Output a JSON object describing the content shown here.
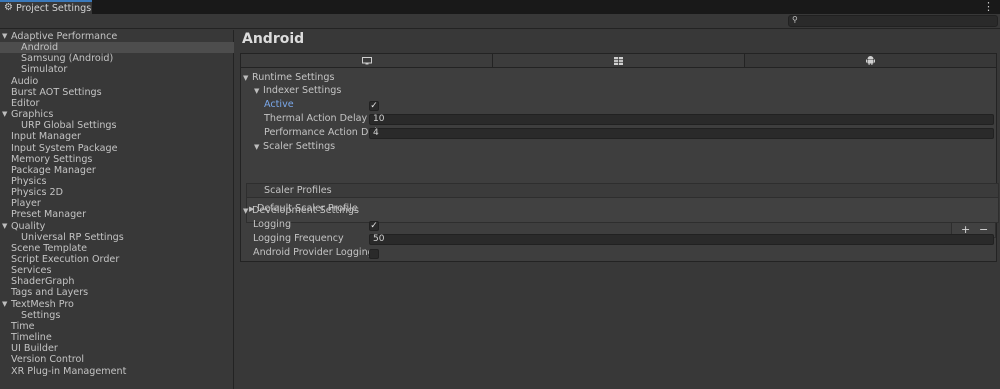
{
  "window": {
    "tab_title": "Project Settings",
    "tab_icon": "gear-icon",
    "menu_icon": "kebab-menu-icon"
  },
  "search": {
    "placeholder": "",
    "value": ""
  },
  "sidebar": {
    "items": [
      {
        "label": "Adaptive Performance",
        "foldout": "▼"
      },
      {
        "label": "Android"
      },
      {
        "label": "Samsung (Android)"
      },
      {
        "label": "Simulator"
      },
      {
        "label": "Audio"
      },
      {
        "label": "Burst AOT Settings"
      },
      {
        "label": "Editor"
      },
      {
        "label": "Graphics",
        "foldout": "▼"
      },
      {
        "label": "URP Global Settings"
      },
      {
        "label": "Input Manager"
      },
      {
        "label": "Input System Package"
      },
      {
        "label": "Memory Settings"
      },
      {
        "label": "Package Manager"
      },
      {
        "label": "Physics"
      },
      {
        "label": "Physics 2D"
      },
      {
        "label": "Player"
      },
      {
        "label": "Preset Manager"
      },
      {
        "label": "Quality",
        "foldout": "▼"
      },
      {
        "label": "Universal RP Settings"
      },
      {
        "label": "Scene Template"
      },
      {
        "label": "Script Execution Order"
      },
      {
        "label": "Services"
      },
      {
        "label": "ShaderGraph"
      },
      {
        "label": "Tags and Layers"
      },
      {
        "label": "TextMesh Pro",
        "foldout": "▼"
      },
      {
        "label": "Settings"
      },
      {
        "label": "Time"
      },
      {
        "label": "Timeline"
      },
      {
        "label": "UI Builder"
      },
      {
        "label": "Version Control"
      },
      {
        "label": "XR Plug-in Management"
      }
    ]
  },
  "main": {
    "title": "Android",
    "platform_tabs": [
      {
        "icon": "desktop-icon"
      },
      {
        "icon": "grid-icon"
      },
      {
        "icon": "android-icon",
        "active": true
      }
    ],
    "runtime": {
      "header": "Runtime Settings",
      "indexer": {
        "header": "Indexer Settings",
        "active_label": "Active",
        "active_checked": true,
        "thermal_label": "Thermal Action Delay",
        "thermal_value": "10",
        "performance_label": "Performance Action Delay",
        "performance_value": "4"
      },
      "scaler": {
        "header": "Scaler Settings",
        "profiles_label": "Scaler Profiles",
        "default_profile_label": "Default Scaler Profile",
        "add_label": "+",
        "remove_label": "−"
      }
    },
    "development": {
      "header": "Development Settings",
      "logging_label": "Logging",
      "logging_checked": true,
      "frequency_label": "Logging Frequency",
      "frequency_value": "50",
      "provider_label": "Android Provider Logging",
      "provider_checked": false
    }
  },
  "colors": {
    "accent": "#3a79bb",
    "active_label": "#7aa8ea",
    "selected_row": "#4d4d4d",
    "background": "#383838"
  }
}
